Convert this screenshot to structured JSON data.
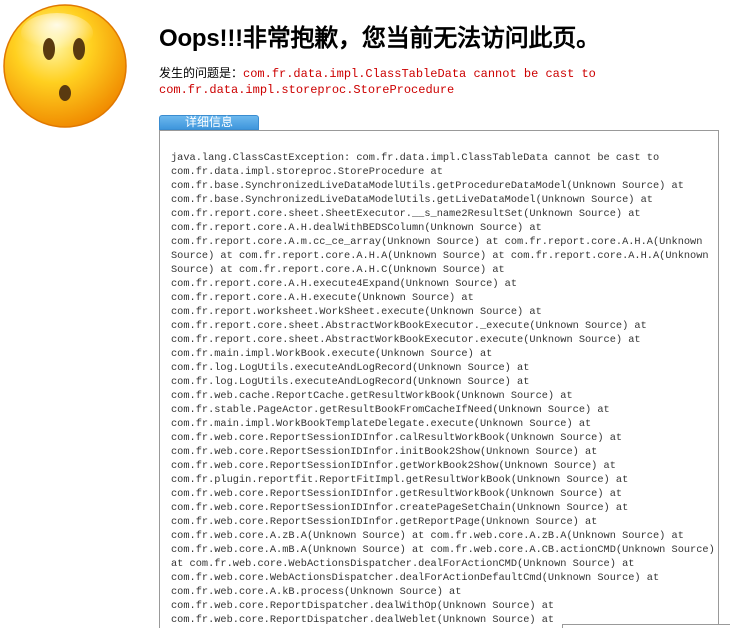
{
  "error_page": {
    "title": "Oops!!!非常抱歉，您当前无法访问此页。",
    "problem_label": "发生的问题是：",
    "problem_message_line1": "com.fr.data.impl.ClassTableData cannot be cast to",
    "problem_message_line2": "com.fr.data.impl.storeproc.StoreProcedure",
    "detail_button_label": "详细信息",
    "face_icon": "sad-face-icon"
  },
  "stack_trace": [
    "java.lang.ClassCastException: com.fr.data.impl.ClassTableData cannot be cast to",
    "com.fr.data.impl.storeproc.StoreProcedure at",
    "com.fr.base.SynchronizedLiveDataModelUtils.getProcedureDataModel(Unknown Source) at",
    "com.fr.base.SynchronizedLiveDataModelUtils.getLiveDataModel(Unknown Source) at",
    "com.fr.report.core.sheet.SheetExecutor.__s_name2ResultSet(Unknown Source) at",
    "com.fr.report.core.A.H.dealWithBEDSColumn(Unknown Source) at",
    "com.fr.report.core.A.m.cc_ce_array(Unknown Source) at com.fr.report.core.A.H.A(Unknown",
    "Source) at com.fr.report.core.A.H.A(Unknown Source) at com.fr.report.core.A.H.A(Unknown",
    "Source) at com.fr.report.core.A.H.C(Unknown Source) at",
    "com.fr.report.core.A.H.execute4Expand(Unknown Source) at",
    "com.fr.report.core.A.H.execute(Unknown Source) at",
    "com.fr.report.worksheet.WorkSheet.execute(Unknown Source) at",
    "com.fr.report.core.sheet.AbstractWorkBookExecutor._execute(Unknown Source) at",
    "com.fr.report.core.sheet.AbstractWorkBookExecutor.execute(Unknown Source) at",
    "com.fr.main.impl.WorkBook.execute(Unknown Source) at",
    "com.fr.log.LogUtils.executeAndLogRecord(Unknown Source) at",
    "com.fr.log.LogUtils.executeAndLogRecord(Unknown Source) at",
    "com.fr.web.cache.ReportCache.getResultWorkBook(Unknown Source) at",
    "com.fr.stable.PageActor.getResultBookFromCacheIfNeed(Unknown Source) at",
    "com.fr.main.impl.WorkBookTemplateDelegate.execute(Unknown Source) at",
    "com.fr.web.core.ReportSessionIDInfor.calResultWorkBook(Unknown Source) at",
    "com.fr.web.core.ReportSessionIDInfor.initBook2Show(Unknown Source) at",
    "com.fr.web.core.ReportSessionIDInfor.getWorkBook2Show(Unknown Source) at",
    "com.fr.plugin.reportfit.ReportFitImpl.getResultWorkBook(Unknown Source) at",
    "com.fr.web.core.ReportSessionIDInfor.getResultWorkBook(Unknown Source) at",
    "com.fr.web.core.ReportSessionIDInfor.createPageSetChain(Unknown Source) at",
    "com.fr.web.core.ReportSessionIDInfor.getReportPage(Unknown Source) at",
    "com.fr.web.core.A.zB.A(Unknown Source) at com.fr.web.core.A.zB.A(Unknown Source) at",
    "com.fr.web.core.A.mB.A(Unknown Source) at com.fr.web.core.A.CB.actionCMD(Unknown Source)",
    "at com.fr.web.core.WebActionsDispatcher.dealForActionCMD(Unknown Source) at",
    "com.fr.web.core.WebActionsDispatcher.dealForActionDefaultCmd(Unknown Source) at",
    "com.fr.web.core.A.kB.process(Unknown Source) at",
    "com.fr.web.core.ReportDispatcher.dealWithOp(Unknown Source) at",
    "com.fr.web.core.ReportDispatcher.dealWeblet(Unknown Source) at"
  ]
}
